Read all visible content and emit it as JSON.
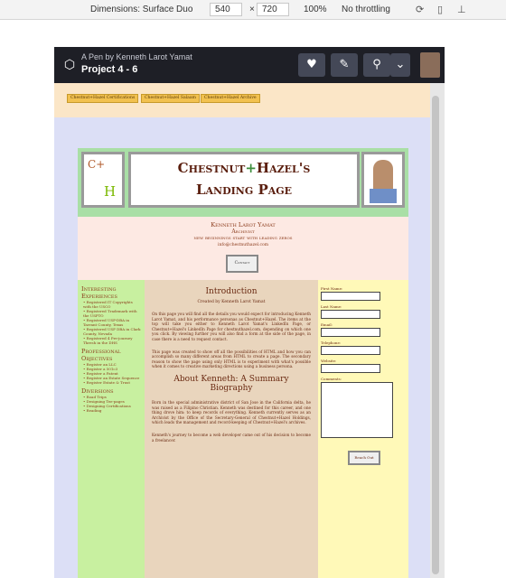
{
  "devtools": {
    "dimensions_label": "Dimensions: Surface Duo",
    "width": "540",
    "times": "×",
    "height": "720",
    "zoom": "100%",
    "throttle": "No throttling"
  },
  "codepen": {
    "byline": "A Pen by Kenneth Larot Yamat",
    "title": "Project 4 - 6"
  },
  "nav": {
    "links": [
      "Chestnut+Hazel Certifications",
      "Chestnut+Hazel Salaam",
      "Chestnut+Hazel Archive"
    ]
  },
  "header": {
    "logo_ch": "C+",
    "logo_h": "H",
    "title_line1_a": "Chestnut",
    "title_line1_plus": "+",
    "title_line1_b": "Hazel's",
    "title_line2": "Landing Page"
  },
  "bio": {
    "name": "Kenneth Larot Yamat",
    "role": "Archivist",
    "tagline": "new beginnings start with leading zeros",
    "email": "info@chestnuthazel.com",
    "contact_label": "Contact"
  },
  "sidebar": {
    "sections": [
      {
        "title": "Interesting Experiences",
        "items": [
          "Registered IT Copyrights with the USCO",
          "Registered Trademark with the USPTO",
          "Registered USP-DBA in Tarrant County, Texas",
          "Registered USP DBA in Clark County, Nevada",
          "Registered 4 Pre-journey Thresh in the DHS"
        ]
      },
      {
        "title": "Professional Objectives",
        "items": [
          "Register an LLC",
          "Register a 501c3",
          "Register a Patent",
          "Register an Estate Sequence",
          "Register Estate & Trust"
        ]
      },
      {
        "title": "Diversions",
        "items": [
          "Road Trips",
          "Designing Tee-pages",
          "Designing Certifications",
          "Reading"
        ]
      }
    ]
  },
  "main": {
    "intro_heading": "Introduction",
    "intro_by": "Created by Kenneth Larot Yamat",
    "p1": "On this page you will find all the details you would expect for introducing Kenneth Larot Yamat, and his performance personas as Chestnut+Hazel. The items at the top will take you either to Kenneth Larot Yamat's LinkedIn Page, or Chestnut+Hazel's LinkedIn Page for chestnuthazel.com, depending on which one you click. By viewing further you will also find a form at the side of the page, in case there is a need to request contact.",
    "p2": "This page was created to show off all the possibilities of HTML and how you can accomplish so many different areas from HTML to create a page. The secondary reason to show the page using only HTML is to experiment with what's possible when it comes to creative marketing directions using a business persona.",
    "about_heading": "About Kenneth: A Summary Biography",
    "p3": "Born in the special administrative district of San Jose in the California delta, he was raised as a Filipino Christian. Kenneth was destined for this career, and one thing drove him: to keep records of everything. Kenneth currently serves as an Archivist by the Office of the Secretary-General of Chestnut+Hazel Holdings, which leads the management and record-keeping of Chestnut+Hazel's archives.",
    "p4": "Kenneth's journey to become a web developer came out of his decision to become a freelancer."
  },
  "form": {
    "labels": [
      "First Name:",
      "Last Name:",
      "Email:",
      "Telephone:",
      "Website:",
      "Comments:"
    ],
    "reach_label": "Reach Out"
  }
}
